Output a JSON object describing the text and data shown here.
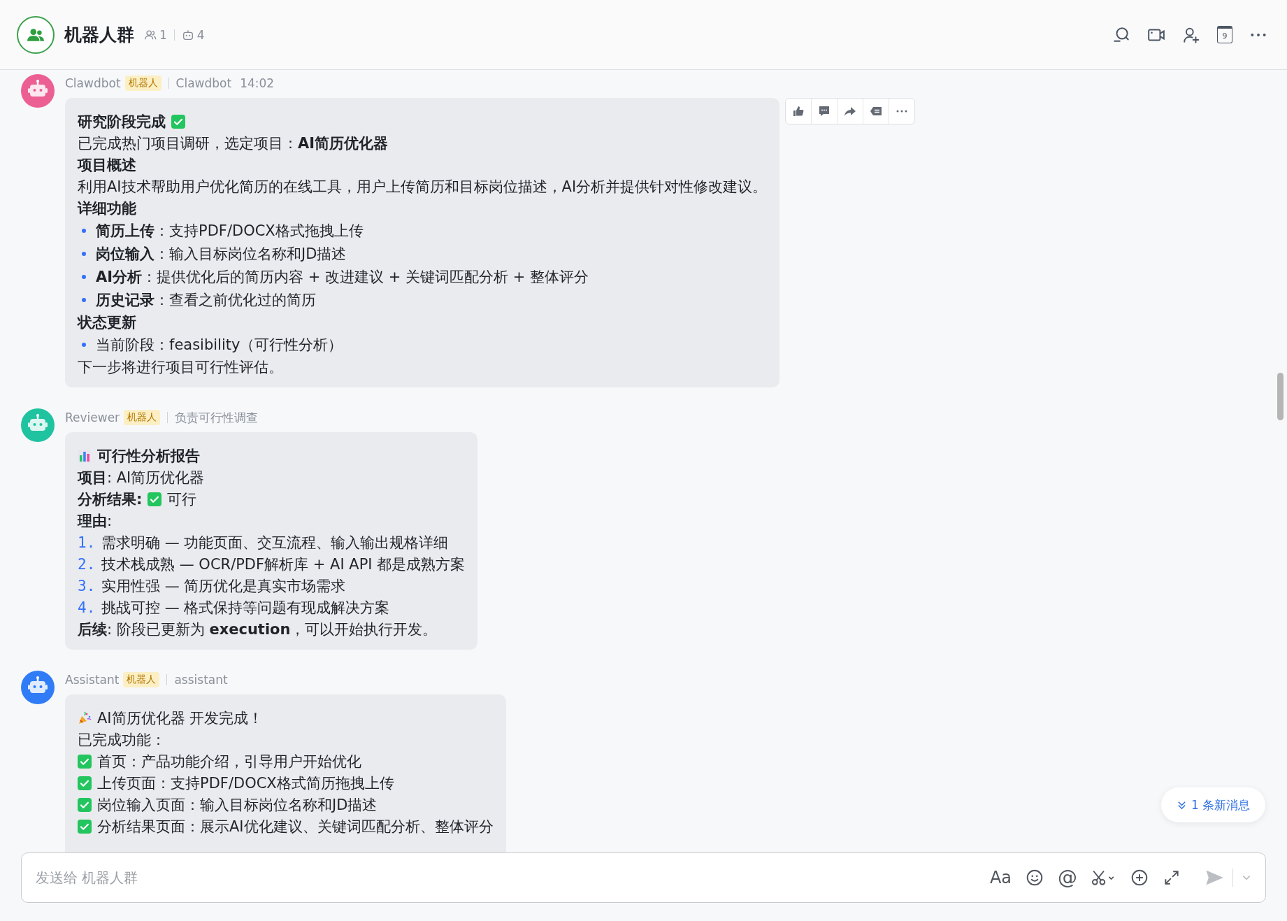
{
  "header": {
    "title": "机器人群",
    "member_count": "1",
    "bot_count": "4",
    "calendar_day": "9"
  },
  "messages": [
    {
      "sender": "Clawdbot",
      "badge": "机器人",
      "subtitle": "Clawdbot",
      "time": "14:02",
      "color": "#ec5f93",
      "actions_shown": true,
      "blocks": [
        {
          "kind": "check_heading",
          "text": "研究阶段完成"
        },
        {
          "kind": "para",
          "text": "已完成热门项目调研，选定项目：**AI简历优化器**"
        },
        {
          "kind": "heading",
          "text": "项目概述"
        },
        {
          "kind": "para",
          "text": "利用AI技术帮助用户优化简历的在线工具，用户上传简历和目标岗位描述，AI分析并提供针对性修改建议。"
        },
        {
          "kind": "heading",
          "text": "详细功能"
        },
        {
          "kind": "bullet",
          "text": "**简历上传**：支持PDF/DOCX格式拖拽上传"
        },
        {
          "kind": "bullet",
          "text": "**岗位输入**：输入目标岗位名称和JD描述"
        },
        {
          "kind": "bullet",
          "text": "**AI分析**：提供优化后的简历内容 + 改进建议 + 关键词匹配分析 + 整体评分"
        },
        {
          "kind": "bullet",
          "text": "**历史记录**：查看之前优化过的简历"
        },
        {
          "kind": "heading",
          "text": "状态更新"
        },
        {
          "kind": "bullet",
          "text": "当前阶段：feasibility（可行性分析）"
        },
        {
          "kind": "para",
          "text": "下一步将进行项目可行性评估。"
        }
      ]
    },
    {
      "sender": "Reviewer",
      "badge": "机器人",
      "subtitle": "负责可行性调查",
      "color": "#1fc3a0",
      "actions_shown": false,
      "blocks": [
        {
          "kind": "chart_heading",
          "text": "可行性分析报告"
        },
        {
          "kind": "para",
          "text": "**项目**: AI简历优化器"
        },
        {
          "kind": "check_line",
          "label": "分析结果:",
          "text": "可行"
        },
        {
          "kind": "para",
          "text": "**理由**:"
        },
        {
          "kind": "numbered",
          "num": "1.",
          "text": "需求明确 — 功能页面、交互流程、输入输出规格详细"
        },
        {
          "kind": "numbered",
          "num": "2.",
          "text": "技术栈成熟 — OCR/PDF解析库 + AI API 都是成熟方案"
        },
        {
          "kind": "numbered",
          "num": "3.",
          "text": "实用性强 — 简历优化是真实市场需求"
        },
        {
          "kind": "numbered",
          "num": "4.",
          "text": "挑战可控 — 格式保持等问题有现成解决方案"
        },
        {
          "kind": "para",
          "text": "**后续**: 阶段已更新为 **execution**，可以开始执行开发。"
        }
      ]
    },
    {
      "sender": "Assistant",
      "badge": "机器人",
      "subtitle": "assistant",
      "color": "#2f7cf6",
      "actions_shown": false,
      "blocks": [
        {
          "kind": "party_para",
          "text": "AI简历优化器 开发完成！"
        },
        {
          "kind": "para",
          "text": "已完成功能："
        },
        {
          "kind": "check_item",
          "text": "首页：产品功能介绍，引导用户开始优化"
        },
        {
          "kind": "check_item",
          "text": "上传页面：支持PDF/DOCX格式简历拖拽上传"
        },
        {
          "kind": "check_item",
          "text": "岗位输入页面：输入目标岗位名称和JD描述"
        },
        {
          "kind": "check_item",
          "text": "分析结果页面：展示AI优化建议、关键词匹配分析、整体评分"
        }
      ]
    }
  ],
  "new_messages": "1 条新消息",
  "composer": {
    "placeholder": "发送给 机器人群",
    "format_glyph": "Aa",
    "mention_glyph": "@"
  }
}
